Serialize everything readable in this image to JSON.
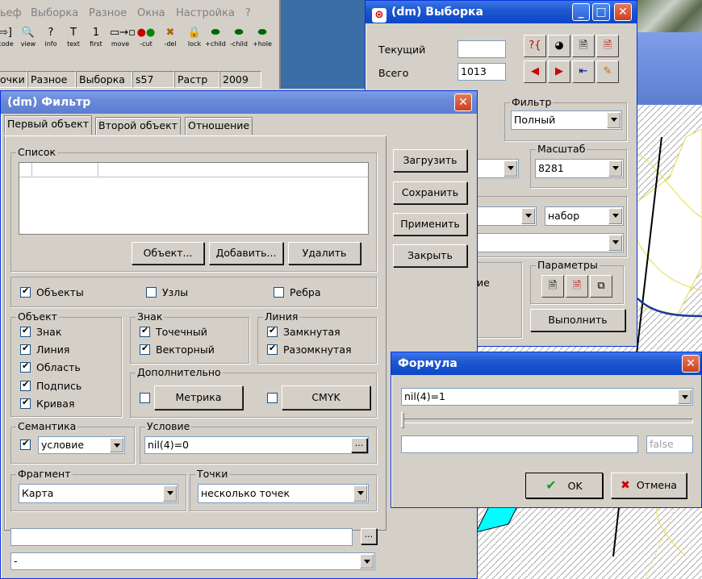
{
  "main_app": {
    "menu": [
      "ьеф",
      "Выборка",
      "Разное",
      "Окна",
      "Настройка",
      "?"
    ],
    "toolbar": [
      {
        "icon": "code-icon",
        "label": "code"
      },
      {
        "icon": "view-icon",
        "label": "view"
      },
      {
        "icon": "info-icon",
        "label": "info"
      },
      {
        "icon": "text-icon",
        "label": "text"
      },
      {
        "icon": "first-icon",
        "label": "first"
      },
      {
        "icon": "move-icon",
        "label": "move"
      },
      {
        "icon": "cut-icon",
        "label": "-cut"
      },
      {
        "icon": "del-icon",
        "label": "-del"
      },
      {
        "icon": "lock-icon",
        "label": "lock"
      },
      {
        "icon": "add-child-icon",
        "label": "+child"
      },
      {
        "icon": "remove-child-icon",
        "label": "-child"
      },
      {
        "icon": "add-hole-icon",
        "label": "+hole"
      }
    ],
    "status": [
      "очки",
      "Разное",
      "Выборка",
      "s57",
      "Растр",
      "2009"
    ]
  },
  "vyborka": {
    "title": "(dm) Выборка",
    "current_label": "Текущий",
    "current_value": "",
    "total_label": "Всего",
    "total_value": "1013",
    "filter_group": "Фильтр",
    "filter_value": "Полный",
    "scale_group": "Масштаб",
    "scale_value": "8281",
    "set_value": "набор",
    "params_group": "Параметры",
    "partial_text": "ие",
    "execute_label": "Выполнить"
  },
  "filter": {
    "title": "(dm) Фильтр",
    "tabs": [
      "Первый объект",
      "Второй объект",
      "Отношение"
    ],
    "list_group": "Список",
    "btn_object": "Объект...",
    "btn_add": "Добавить...",
    "btn_delete": "Удалить",
    "btn_load": "Загрузить",
    "btn_save": "Сохранить",
    "btn_apply": "Применить",
    "btn_close": "Закрыть",
    "cb_objects": "Объекты",
    "cb_nodes": "Узлы",
    "cb_edges": "Ребра",
    "object_group": "Объект",
    "object_items": [
      "Знак",
      "Линия",
      "Область",
      "Подпись",
      "Кривая"
    ],
    "sign_group": "Знак",
    "sign_items": [
      "Точечный",
      "Векторный"
    ],
    "line_group": "Линия",
    "line_items": [
      "Замкнутая",
      "Разомкнутая"
    ],
    "extra_group": "Дополнительно",
    "btn_metric": "Метрика",
    "btn_cmyk": "CMYK",
    "semantics_group": "Семантика",
    "semantics_value": "условие",
    "condition_group": "Условие",
    "condition_value": "nil(4)=0",
    "fragment_group": "Фрагмент",
    "fragment_value": "Карта",
    "points_group": "Точки",
    "points_value": "несколько точек",
    "bottom_field": "",
    "bottom_combo": "-",
    "ellipsis": "..."
  },
  "formula": {
    "title": "Формула",
    "expression": "nil(4)=1",
    "result_field": "",
    "result_value": "false",
    "ok_label": "OK",
    "cancel_label": "Отмена"
  },
  "colors": {
    "title_active": "#0a46c8",
    "water": "#00ffff",
    "map_line": "#1a3a9a",
    "contour": "#e8e060"
  }
}
